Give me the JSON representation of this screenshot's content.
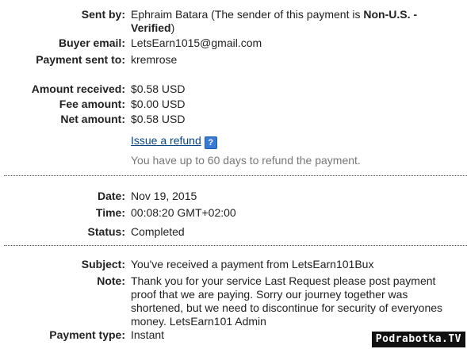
{
  "payment_info": {
    "sent_by_label": "Sent by:",
    "sent_by_name": "Ephraim Batara",
    "sent_by_note_prefix": " (The sender of this payment is ",
    "sent_by_status_line1": "Non-U.S. -",
    "sent_by_status_line2": "Verified",
    "sent_by_note_suffix": ")",
    "buyer_email_label": "Buyer email:",
    "buyer_email": "LetsEarn1015@gmail.com",
    "payment_sent_to_label": "Payment sent to:",
    "payment_sent_to": "kremrose"
  },
  "amounts": {
    "amount_received_label": "Amount received:",
    "amount_received": "$0.58 USD",
    "fee_amount_label": "Fee amount:",
    "fee_amount": "$0.00 USD",
    "net_amount_label": "Net amount:",
    "net_amount": "$0.58 USD",
    "refund_link": "Issue a refund",
    "help_icon_glyph": "?",
    "refund_note": "You have up to 60 days to refund the payment."
  },
  "details": {
    "date_label": "Date:",
    "date": "Nov 19, 2015",
    "time_label": "Time:",
    "time": "00:08:20 GMT+02:00",
    "status_label": "Status:",
    "status": "Completed"
  },
  "message": {
    "subject_label": "Subject:",
    "subject": "You've received a payment from LetsEarn101Bux",
    "note_label": "Note:",
    "note_lines": [
      "Thank you for your service Last Request please post payment",
      "proof that we are paying. Sorry our journey together was",
      "shortened, but we need to discontinue for security of everyones",
      "money. LetsEarn101 Admin"
    ],
    "payment_type_label": "Payment type:",
    "payment_type": "Instant"
  },
  "watermark": "Podrabotka.TV",
  "colors": {
    "link": "#084482",
    "help_icon": "#3a7bd5",
    "separator": "#555555",
    "muted": "#777777"
  }
}
